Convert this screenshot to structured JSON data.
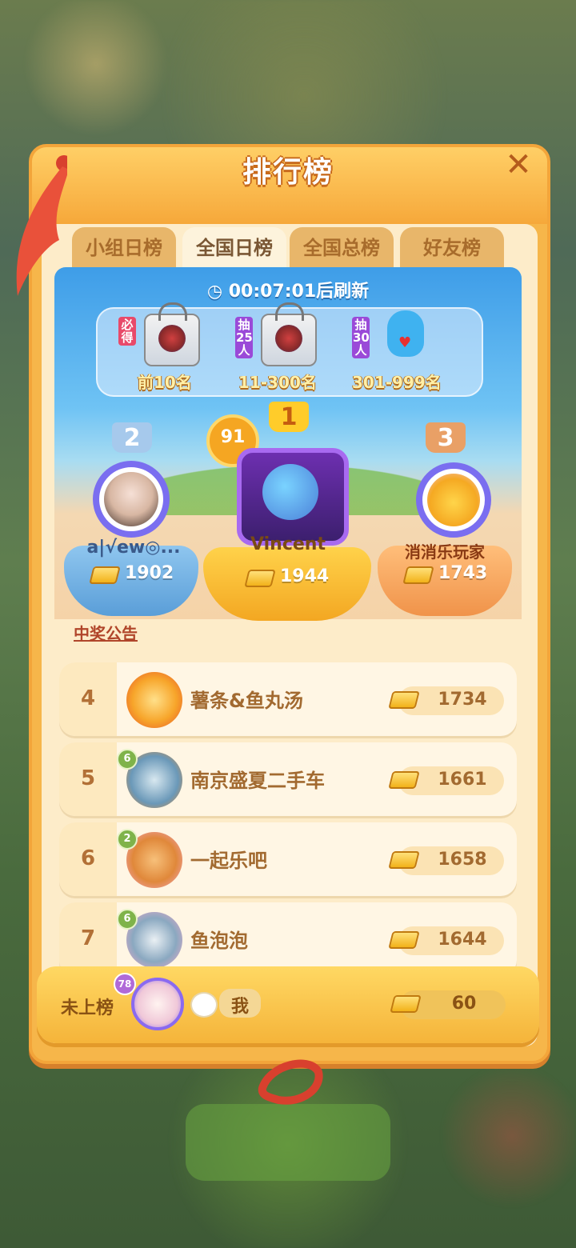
{
  "header": {
    "title": "排行榜"
  },
  "tabs": [
    {
      "label": "小组日榜",
      "active": false
    },
    {
      "label": "全国日榜",
      "active": true
    },
    {
      "label": "全国总榜",
      "active": false
    },
    {
      "label": "好友榜",
      "active": false
    }
  ],
  "arena": {
    "timer": "00:07:01",
    "timer_suffix": "后刷新",
    "rewards": [
      {
        "tag": "必得",
        "range": "前10名",
        "tag_color": "#e84a6a"
      },
      {
        "tag": "抽25人",
        "range": "11-300名",
        "tag_color": "#9a4ad8"
      },
      {
        "tag": "抽30人",
        "range": "301-999名",
        "tag_color": "#9a4ad8"
      }
    ],
    "podium": [
      {
        "rank": "2",
        "name": "a|√ew◎...",
        "score": "1902"
      },
      {
        "rank": "1",
        "name": "Vincent",
        "score": "1944",
        "level": "91"
      },
      {
        "rank": "3",
        "name": "消消乐玩家",
        "score": "1743"
      }
    ],
    "notice_link": "中奖公告"
  },
  "list": [
    {
      "rank": "4",
      "name": "薯条&鱼丸汤",
      "score": "1734",
      "level": ""
    },
    {
      "rank": "5",
      "name": "南京盛夏二手车",
      "score": "1661",
      "level": "6"
    },
    {
      "rank": "6",
      "name": "一起乐吧",
      "score": "1658",
      "level": "2"
    },
    {
      "rank": "7",
      "name": "鱼泡泡",
      "score": "1644",
      "level": "6"
    }
  ],
  "me": {
    "status": "未上榜",
    "level": "78",
    "name": "我",
    "score": "60"
  },
  "colors": {
    "panel": "#f6b64a",
    "accent_text": "#a26a30",
    "notice": "#b0452a"
  }
}
